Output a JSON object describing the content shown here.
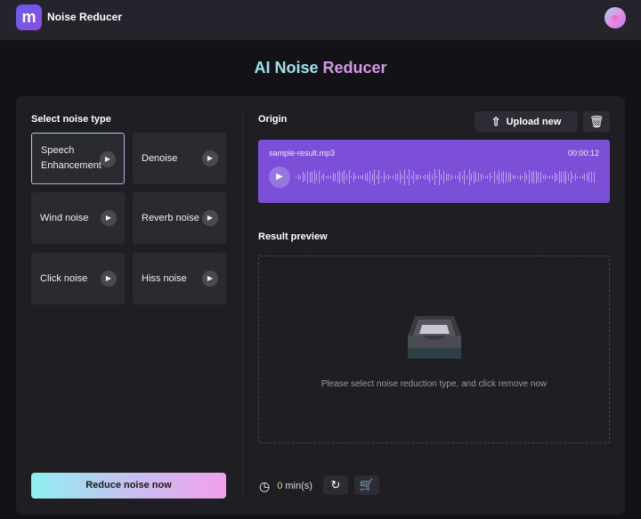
{
  "header": {
    "logo_text": "m",
    "app_name": "Noise Reducer"
  },
  "title": {
    "part1": "AI Noise",
    "part2": "Reducer"
  },
  "left": {
    "label": "Select noise type",
    "noise_types": [
      {
        "label": "Speech Enhancement",
        "selected": true
      },
      {
        "label": "Denoise"
      },
      {
        "label": "Wind noise"
      },
      {
        "label": "Reverb noise"
      },
      {
        "label": "Click noise"
      },
      {
        "label": "Hiss noise"
      }
    ],
    "reduce_button": "Reduce noise now"
  },
  "origin": {
    "label": "Origin",
    "upload_button": "Upload new",
    "file_name": "sample-result.mp3",
    "duration": "00:00:12"
  },
  "result": {
    "label": "Result preview",
    "hint": "Please select noise reduction type, and click remove now"
  },
  "footer": {
    "minutes_value": "0",
    "minutes_unit": "min(s)"
  },
  "colors": {
    "accent": "#7b4fd8",
    "minutes": "#e8d08a"
  }
}
